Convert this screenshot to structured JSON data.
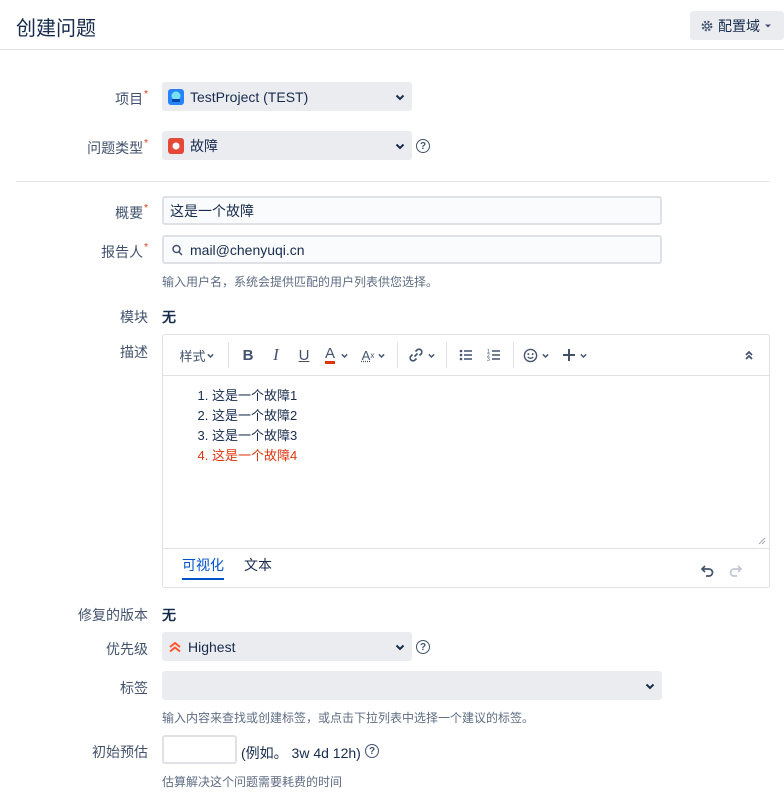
{
  "header": {
    "title": "创建问题",
    "config_label": "配置域"
  },
  "project": {
    "label": "项目",
    "value": "TestProject (TEST)"
  },
  "issue_type": {
    "label": "问题类型",
    "value": "故障"
  },
  "summary": {
    "label": "概要",
    "value": "这是一个故障"
  },
  "reporter": {
    "label": "报告人",
    "value": "mail@chenyuqi.cn",
    "help": "输入用户名，系统会提供匹配的用户列表供您选择。"
  },
  "component": {
    "label": "模块",
    "value": "无"
  },
  "description": {
    "label": "描述",
    "toolbar": {
      "style_label": "样式"
    },
    "items": [
      "这是一个故障1",
      "这是一个故障2",
      "这是一个故障3",
      "这是一个故障4"
    ],
    "tabs": [
      "可视化",
      "文本"
    ],
    "colors": {
      "highlight_item": "#de350b",
      "active_tab": "#0052cc"
    }
  },
  "fix_version": {
    "label": "修复的版本",
    "value": "无"
  },
  "priority": {
    "label": "优先级",
    "value": "Highest"
  },
  "labels": {
    "label": "标签",
    "help": "输入内容来查找或创建标签，或点击下拉列表中选择一个建议的标签。"
  },
  "estimate": {
    "label": "初始预估",
    "example": "(例如。 3w 4d 12h)",
    "help": "估算解决这个问题需要耗费的时间"
  }
}
